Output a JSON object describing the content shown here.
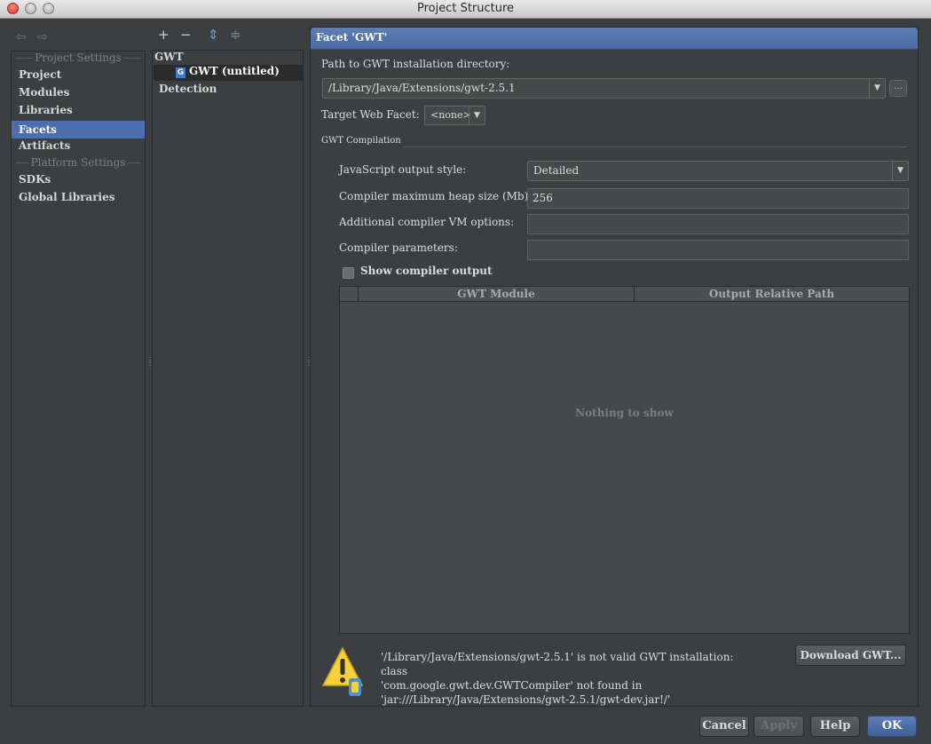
{
  "window": {
    "title": "Project Structure"
  },
  "nav": {
    "back": "⇦",
    "forward": "⇨"
  },
  "left": {
    "project_settings_header": "Project Settings",
    "platform_settings_header": "Platform Settings",
    "items": {
      "project": "Project",
      "modules": "Modules",
      "libraries": "Libraries",
      "facets": "Facets",
      "artifacts": "Artifacts",
      "sdks": "SDKs",
      "global_libraries": "Global Libraries"
    },
    "selected": "facets"
  },
  "middle": {
    "toolbar": {
      "add": "+",
      "remove": "−",
      "expand": "⇕",
      "collapse": "≑"
    },
    "tree": {
      "group": "GWT",
      "facet": "GWT (untitled)",
      "icon_letter": "G",
      "detection": "Detection"
    }
  },
  "right": {
    "header": "Facet 'GWT'",
    "path_label": "Path to GWT installation directory:",
    "path_value": "/Library/Java/Extensions/gwt-2.5.1",
    "browse_label": "...",
    "target_label": "Target Web Facet:",
    "target_value": "<none>",
    "group_title": "GWT Compilation",
    "js_style_label": "JavaScript output style:",
    "js_style_value": "Detailed",
    "heap_label": "Compiler maximum heap size (Mb):",
    "heap_value": "256",
    "vm_label": "Additional compiler VM options:",
    "vm_value": "",
    "params_label": "Compiler parameters:",
    "params_value": "",
    "show_output_label": "Show compiler output",
    "show_output_checked": false,
    "table": {
      "columns": [
        "GWT Module",
        "Output Relative Path"
      ],
      "empty": "Nothing to show"
    },
    "warning": {
      "line1": "'/Library/Java/Extensions/gwt-2.5.1' is not valid GWT installation: class",
      "line2": "'com.google.gwt.dev.GWTCompiler' not found in",
      "line3": "'jar:///Library/Java/Extensions/gwt-2.5.1/gwt-dev.jar!/'"
    },
    "download_label": "Download GWT..."
  },
  "buttons": {
    "cancel": "Cancel",
    "apply": "Apply",
    "help": "Help",
    "ok": "OK"
  },
  "colors": {
    "background": "#3c3f41",
    "selection": "#4b6eaf",
    "header": "#5c7fb7"
  }
}
